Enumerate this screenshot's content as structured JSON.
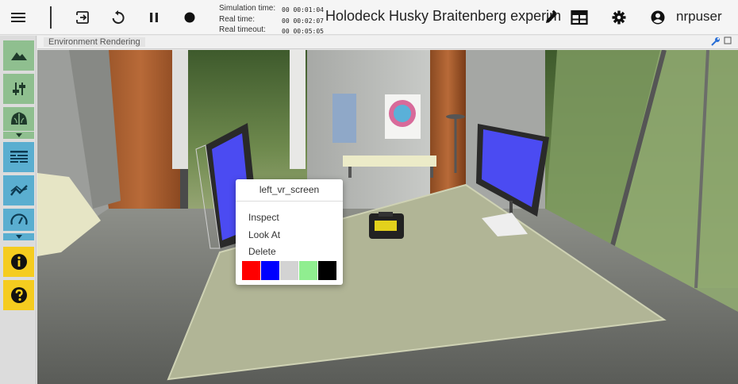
{
  "toolbar": {
    "icons": [
      "menu-icon",
      "exit-icon",
      "reset-icon",
      "pause-icon",
      "record-icon",
      "edit-icon",
      "layout-icon",
      "gear-icon",
      "account-icon"
    ],
    "timing": {
      "sim_label": "Simulation time:",
      "sim_value": "00 00:01:04",
      "real_label": "Real time:",
      "real_value": "00 00:02:07",
      "timeout_label": "Real timeout:",
      "timeout_value": "00 00:05:05"
    },
    "title": "Holodeck Husky Braitenberg experiment",
    "user": "nrpuser"
  },
  "sidebar": {
    "items": [
      {
        "name": "environment-icon",
        "color": "#8fbf8f"
      },
      {
        "name": "object-inspector-icon",
        "color": "#8fbf8f"
      },
      {
        "name": "brain-icon",
        "color": "#8fbf8f"
      },
      {
        "name": "log-console-icon",
        "color": "#5aaed0"
      },
      {
        "name": "plot-icon",
        "color": "#5aaed0"
      },
      {
        "name": "performance-icon",
        "color": "#5aaed0"
      },
      {
        "name": "info-icon",
        "color": "#f5cc1f"
      },
      {
        "name": "help-icon",
        "color": "#f5cc1f"
      }
    ]
  },
  "panel": {
    "tab_label": "Environment Rendering"
  },
  "context_menu": {
    "title": "left_vr_screen",
    "items": [
      "Inspect",
      "Look At",
      "Delete"
    ],
    "colors": [
      "#ff0000",
      "#0000ff",
      "#d3d3d3",
      "#90ee90",
      "#000000"
    ]
  }
}
